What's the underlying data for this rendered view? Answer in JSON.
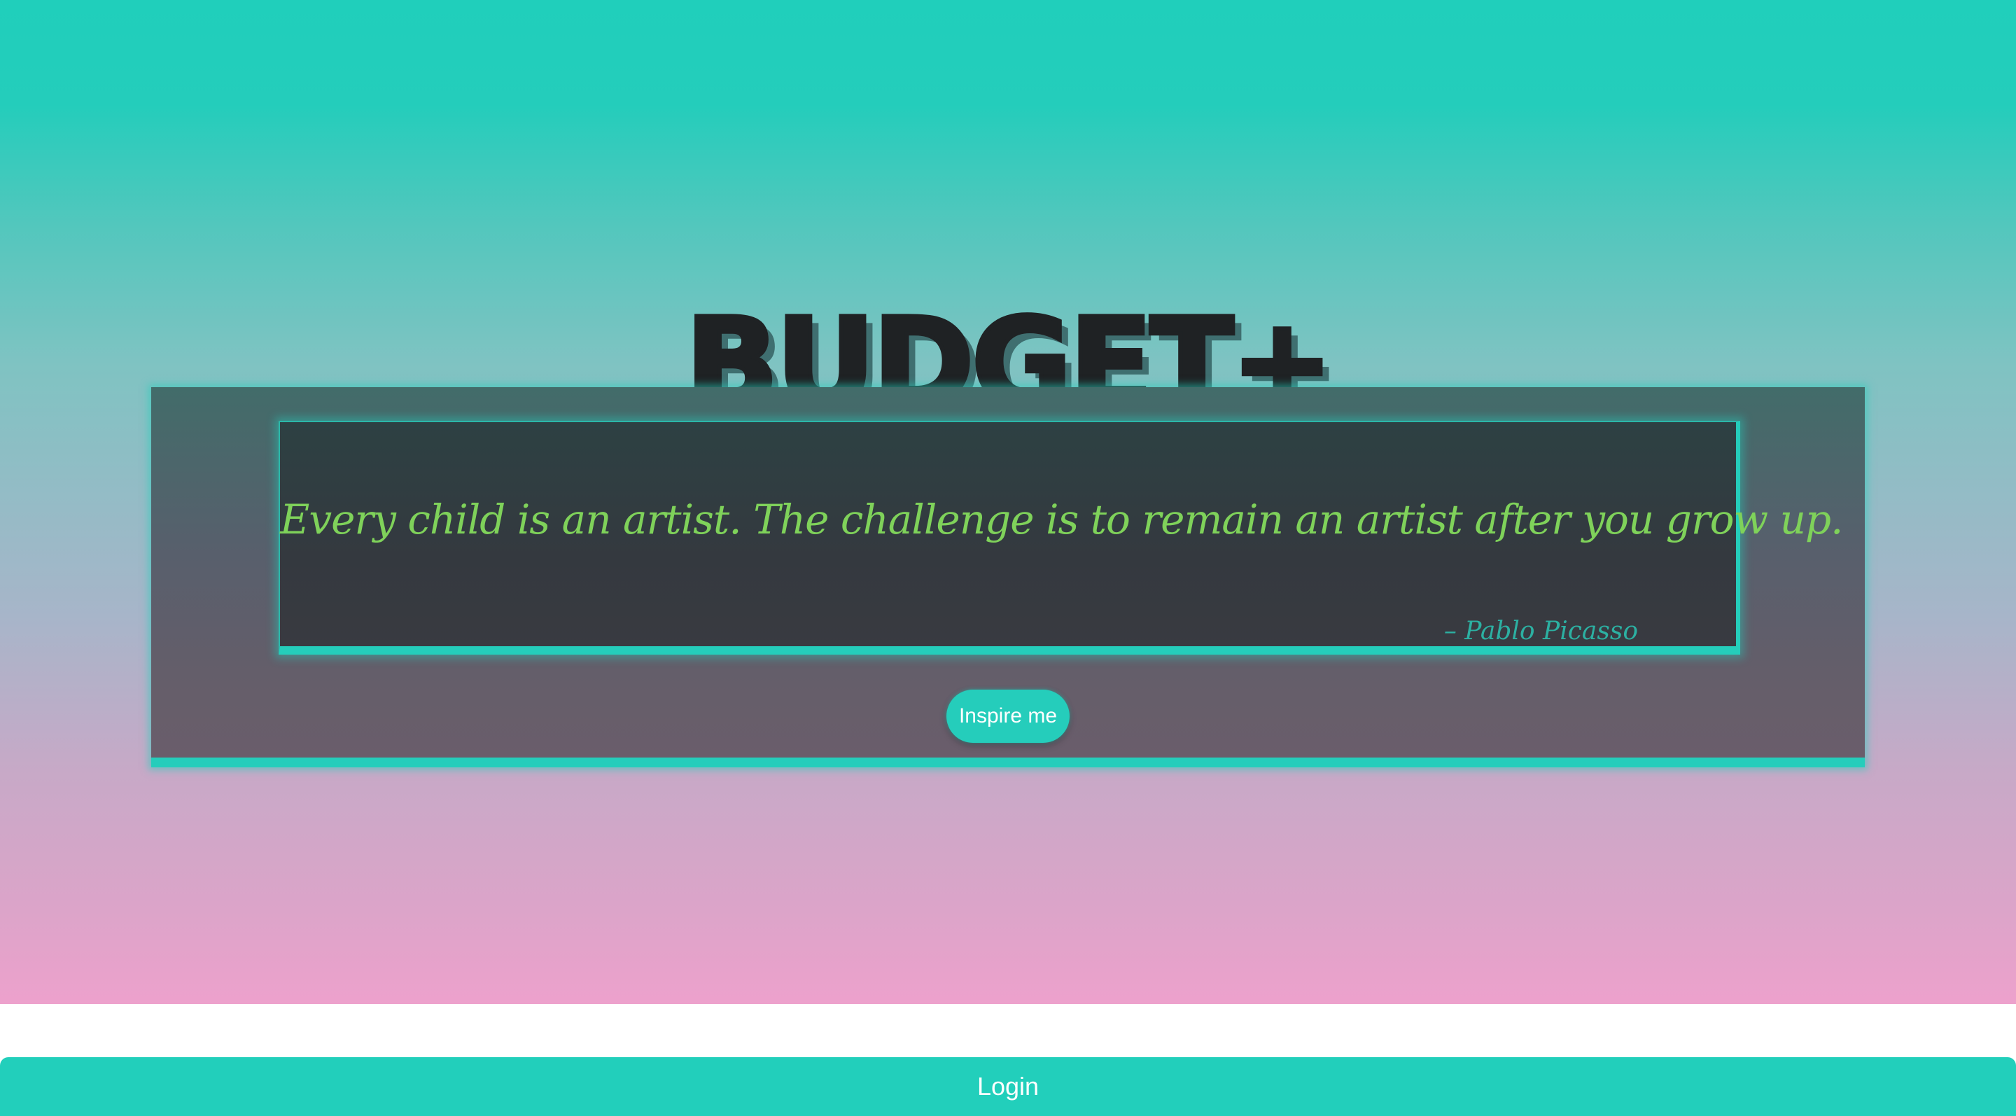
{
  "app": {
    "brand": "BUDGET+"
  },
  "quote": {
    "text": "Every child is an artist. The challenge is to remain an artist after you grow up.",
    "author": "– Pablo Picasso"
  },
  "actions": {
    "inspire_label": "Inspire me",
    "login_label": "Login"
  },
  "colors": {
    "accent": "#22cfbb",
    "quote_text": "#7fd25a",
    "author_text": "#2cb0a2",
    "gradient_top": "#20cfbb",
    "gradient_bottom": "#eda1cc"
  }
}
